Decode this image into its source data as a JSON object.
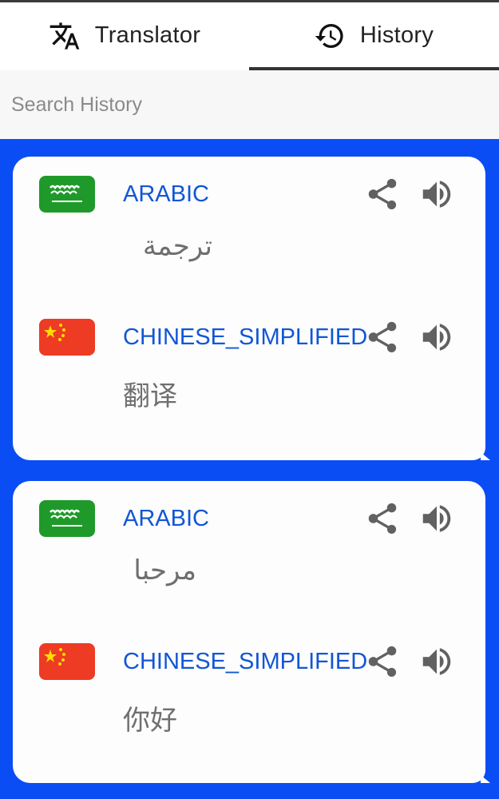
{
  "tabs": [
    {
      "label": "Translator",
      "icon": "translate-icon",
      "selected": false
    },
    {
      "label": "History",
      "icon": "history-icon",
      "selected": true
    }
  ],
  "search": {
    "placeholder": "Search History",
    "value": ""
  },
  "colors": {
    "accent": "#0b4df5",
    "language_label": "#1156d6",
    "text": "#6f6f6f"
  },
  "history": [
    {
      "source": {
        "language": "ARABIC",
        "text": "ترجمة",
        "flag": "saudi-arabia-flag"
      },
      "target": {
        "language": "CHINESE_SIMPLIFIED",
        "text": "翻译",
        "flag": "china-flag"
      }
    },
    {
      "source": {
        "language": "ARABIC",
        "text": "مرحبا",
        "flag": "saudi-arabia-flag"
      },
      "target": {
        "language": "CHINESE_SIMPLIFIED",
        "text": "你好",
        "flag": "china-flag"
      }
    }
  ]
}
